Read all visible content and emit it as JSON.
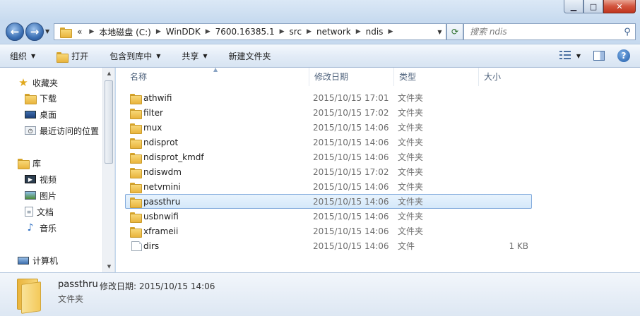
{
  "window": {
    "caption_min": "▁",
    "caption_max": "□",
    "caption_close": "✕"
  },
  "address": {
    "overflow": "«",
    "crumbs": [
      "本地磁盘 (C:)",
      "WinDDK",
      "7600.16385.1",
      "src",
      "network",
      "ndis"
    ],
    "search_placeholder": "搜索 ndis"
  },
  "toolbar": {
    "organize": "组织",
    "open": "打开",
    "include_in_library": "包含到库中",
    "share": "共享",
    "new_folder": "新建文件夹"
  },
  "nav": {
    "favorites": "收藏夹",
    "downloads": "下载",
    "desktop": "桌面",
    "recent": "最近访问的位置",
    "libraries": "库",
    "videos": "视频",
    "pictures": "图片",
    "documents": "文档",
    "music": "音乐",
    "computer": "计算机"
  },
  "columns": {
    "name": "名称",
    "date": "修改日期",
    "type": "类型",
    "size": "大小"
  },
  "files": [
    {
      "name": "athwifi",
      "date": "2015/10/15 17:01",
      "type": "文件夹",
      "size": "",
      "kind": "folder"
    },
    {
      "name": "filter",
      "date": "2015/10/15 17:02",
      "type": "文件夹",
      "size": "",
      "kind": "folder"
    },
    {
      "name": "mux",
      "date": "2015/10/15 14:06",
      "type": "文件夹",
      "size": "",
      "kind": "folder"
    },
    {
      "name": "ndisprot",
      "date": "2015/10/15 14:06",
      "type": "文件夹",
      "size": "",
      "kind": "folder"
    },
    {
      "name": "ndisprot_kmdf",
      "date": "2015/10/15 14:06",
      "type": "文件夹",
      "size": "",
      "kind": "folder"
    },
    {
      "name": "ndiswdm",
      "date": "2015/10/15 17:02",
      "type": "文件夹",
      "size": "",
      "kind": "folder"
    },
    {
      "name": "netvmini",
      "date": "2015/10/15 14:06",
      "type": "文件夹",
      "size": "",
      "kind": "folder"
    },
    {
      "name": "passthru",
      "date": "2015/10/15 14:06",
      "type": "文件夹",
      "size": "",
      "kind": "folder",
      "selected": true
    },
    {
      "name": "usbnwifi",
      "date": "2015/10/15 14:06",
      "type": "文件夹",
      "size": "",
      "kind": "folder"
    },
    {
      "name": "xframeii",
      "date": "2015/10/15 14:06",
      "type": "文件夹",
      "size": "",
      "kind": "folder"
    },
    {
      "name": "dirs",
      "date": "2015/10/15 14:06",
      "type": "文件",
      "size": "1 KB",
      "kind": "file"
    }
  ],
  "details": {
    "name": "passthru",
    "modified": "修改日期: 2015/10/15 14:06",
    "type": "文件夹"
  }
}
